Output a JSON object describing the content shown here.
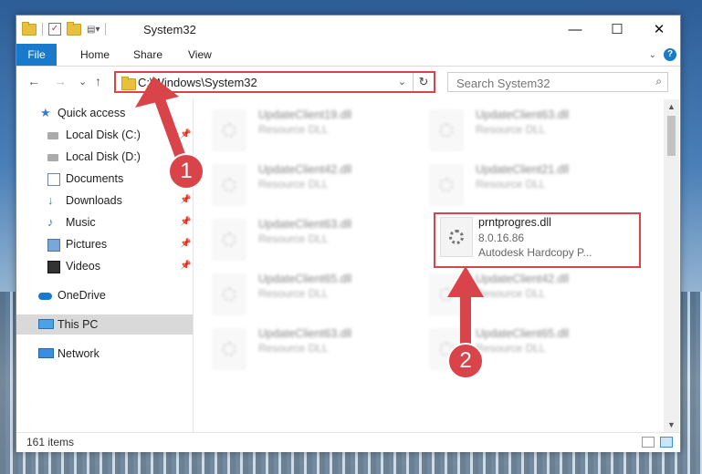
{
  "window": {
    "title": "System32"
  },
  "titlebar": {
    "minimize": "—",
    "maximize": "☐",
    "close": "✕"
  },
  "ribbon": {
    "tabs": [
      "File",
      "Home",
      "Share",
      "View"
    ],
    "help": "?"
  },
  "nav": {
    "back": "←",
    "forward": "→",
    "recent": "⌄",
    "up": "↑"
  },
  "address": {
    "path": "C:\\Windows\\System32",
    "dropdown": "⌄",
    "refresh": "↻"
  },
  "search": {
    "placeholder": "Search System32",
    "icon": "⌕"
  },
  "sidebar": {
    "items": [
      {
        "label": "Quick access",
        "icon": "star-icon",
        "pinned": false
      },
      {
        "label": "Local Disk (C:)",
        "icon": "drive-icon",
        "pinned": true
      },
      {
        "label": "Local Disk (D:)",
        "icon": "drive-icon",
        "pinned": false
      },
      {
        "label": "Documents",
        "icon": "documents-icon",
        "pinned": true
      },
      {
        "label": "Downloads",
        "icon": "download-icon",
        "pinned": true
      },
      {
        "label": "Music",
        "icon": "music-icon",
        "pinned": true
      },
      {
        "label": "Pictures",
        "icon": "pictures-icon",
        "pinned": true
      },
      {
        "label": "Videos",
        "icon": "videos-icon",
        "pinned": true
      },
      {
        "label": "OneDrive",
        "icon": "onedrive-icon",
        "pinned": false
      },
      {
        "label": "This PC",
        "icon": "pc-icon",
        "pinned": false,
        "selected": true
      },
      {
        "label": "Network",
        "icon": "network-icon",
        "pinned": false
      }
    ],
    "pin_glyph": "📌"
  },
  "files": [
    {
      "name": "UpdateClient19.dll",
      "type": "Resource DLL",
      "blurred": true
    },
    {
      "name": "UpdateClient63.dll",
      "type": "Resource DLL",
      "blurred": true
    },
    {
      "name": "UpdateClient42.dll",
      "type": "Resource DLL",
      "blurred": true
    },
    {
      "name": "UpdateClient21.dll",
      "type": "Resource DLL",
      "blurred": true
    },
    {
      "name": "UpdateClient63.dll",
      "type": "Resource DLL",
      "blurred": true
    },
    {
      "name": "prntprogres.dll",
      "version": "8.0.16.86",
      "type": "Autodesk Hardcopy P...",
      "blurred": false,
      "highlighted": true
    },
    {
      "name": "UpdateClient65.dll",
      "type": "Resource DLL",
      "blurred": true
    },
    {
      "name": "UpdateClient42.dll",
      "type": "Resource DLL",
      "blurred": true
    },
    {
      "name": "UpdateClient63.dll",
      "type": "Resource DLL",
      "blurred": true
    },
    {
      "name": "UpdateClient65.dll",
      "type": "Resource DLL",
      "blurred": true
    }
  ],
  "status": {
    "count": "161 items"
  },
  "annotations": {
    "step1": "1",
    "step2": "2"
  },
  "colors": {
    "accent": "#1979ca",
    "annotation_red": "#d9444a",
    "selected_bg": "#d9d9d9"
  }
}
